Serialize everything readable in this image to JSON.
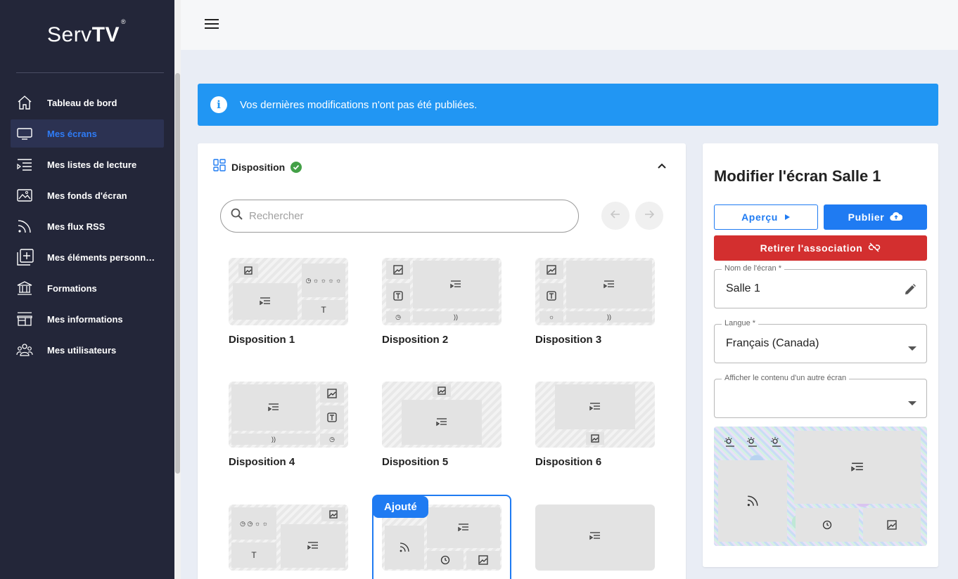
{
  "brand": {
    "name_light": "Serv",
    "name_bold": "TV",
    "mark": "®"
  },
  "sidebar": {
    "items": [
      {
        "label": "Tableau de bord",
        "icon": "home-icon",
        "active": false
      },
      {
        "label": "Mes écrans",
        "icon": "monitor-icon",
        "active": true
      },
      {
        "label": "Mes listes de lecture",
        "icon": "playlist-icon",
        "active": false
      },
      {
        "label": "Mes fonds d'écran",
        "icon": "image-icon",
        "active": false
      },
      {
        "label": "Mes flux RSS",
        "icon": "rss-icon",
        "active": false
      },
      {
        "label": "Mes éléments personnali…",
        "icon": "add-box-icon",
        "active": false
      },
      {
        "label": "Formations",
        "icon": "institution-icon",
        "active": false
      },
      {
        "label": "Mes informations",
        "icon": "store-icon",
        "active": false
      },
      {
        "label": "Mes utilisateurs",
        "icon": "users-icon",
        "active": false
      }
    ]
  },
  "alert": {
    "text": "Vos dernières modifications n'ont pas été publiées."
  },
  "layout_panel": {
    "title": "Disposition",
    "search_placeholder": "Rechercher",
    "added_badge": "Ajouté",
    "layouts": [
      {
        "label": "Disposition 1"
      },
      {
        "label": "Disposition 2"
      },
      {
        "label": "Disposition 3"
      },
      {
        "label": "Disposition 4"
      },
      {
        "label": "Disposition 5"
      },
      {
        "label": "Disposition 6"
      }
    ]
  },
  "edit_panel": {
    "title": "Modifier l'écran Salle 1",
    "apercu_label": "Aperçu",
    "publier_label": "Publier",
    "retirer_label": "Retirer l'association",
    "name_field": {
      "label": "Nom de l'écran *",
      "value": "Salle 1"
    },
    "language_field": {
      "label": "Langue *",
      "value": "Français (Canada)"
    },
    "other_screen_field": {
      "label": "Afficher le contenu d'un autre écran",
      "value": ""
    }
  },
  "colors": {
    "sidebar_bg": "#232639",
    "accent": "#1f7bf2",
    "alert_bg": "#2196f3",
    "danger": "#d32f2f",
    "success": "#43a047"
  }
}
